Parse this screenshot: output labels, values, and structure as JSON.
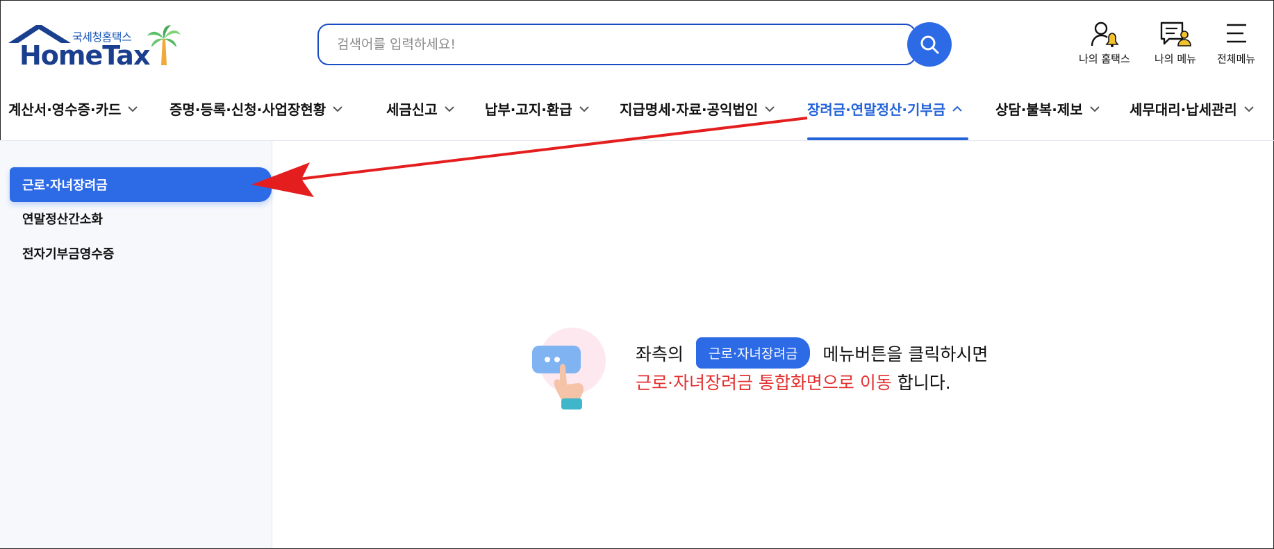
{
  "logo": {
    "small_text": "국세청홈택스",
    "brand_text": "HomeTax"
  },
  "search": {
    "placeholder": "검색어를 입력하세요!"
  },
  "utilities": [
    {
      "label": "나의 홈택스",
      "icon": "user-bell-icon"
    },
    {
      "label": "나의 메뉴",
      "icon": "menu-user-icon"
    },
    {
      "label": "전체메뉴",
      "icon": "hamburger-icon"
    }
  ],
  "nav": {
    "items": [
      {
        "label": "계산서·영수증·카드"
      },
      {
        "label": "증명·등록·신청·사업장현황"
      },
      {
        "label": "세금신고"
      },
      {
        "label": "납부·고지·환급"
      },
      {
        "label": "지급명세·자료·공익법인"
      },
      {
        "label": "장려금·연말정산·기부금",
        "active": true
      },
      {
        "label": "상담·불복·제보"
      },
      {
        "label": "세무대리·납세관리"
      }
    ]
  },
  "sidebar": {
    "items": [
      {
        "label": "근로·자녀장려금",
        "active": true
      },
      {
        "label": "연말정산간소화"
      },
      {
        "label": "전자기부금영수증"
      }
    ]
  },
  "message": {
    "prefix": "좌측의",
    "chip": "근로·자녀장려금",
    "suffix": "메뉴버튼을 클릭하시면",
    "highlight": "근로·자녀장려금 통합화면으로 이동",
    "end": "합니다."
  },
  "colors": {
    "accent": "#2d6ae6",
    "annotation_arrow": "#e41e1e",
    "highlight_text": "#e33030"
  }
}
